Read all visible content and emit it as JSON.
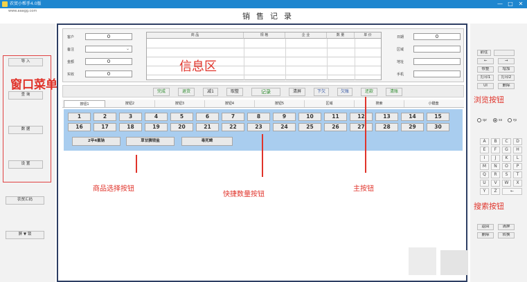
{
  "window": {
    "title": "农贸小帮手4.0版",
    "site": "www.aaagg.com",
    "controls": [
      "—",
      "□",
      "✕"
    ]
  },
  "app_title": "销售记录",
  "left_menu": {
    "buttons": [
      "导 入",
      "查 询",
      "数 据",
      "设 置"
    ],
    "bottom_buttons": [
      "农贸汇码",
      "屏 ▼ 锁"
    ],
    "annotation": "窗口菜单"
  },
  "info_zone": {
    "annotation": "信息区",
    "left_fields": [
      {
        "label": "客户",
        "value": "0"
      },
      {
        "label": "备注",
        "value": ""
      },
      {
        "label": "金额",
        "value": "0"
      },
      {
        "label": "实收",
        "value": "0"
      }
    ],
    "table_headers": [
      "商 品",
      "规 格",
      "企 业",
      "数 量",
      "单 价"
    ],
    "right_fields": [
      {
        "label": "日期",
        "value": "0"
      },
      {
        "label": "区域",
        "value": ""
      },
      {
        "label": "地址",
        "value": ""
      },
      {
        "label": "手机",
        "value": ""
      }
    ]
  },
  "main_buttons": {
    "annotation": "主按钮",
    "labels": [
      "完成",
      "退货",
      "减1",
      "取整",
      "记录",
      "清屏",
      "下欠",
      "欠账",
      "还款",
      "清账"
    ]
  },
  "tabs": [
    "按钮1",
    "按钮2",
    "按钮3",
    "按钮4",
    "按钮5",
    "区域",
    "搜索",
    "小键盘"
  ],
  "quantity": {
    "annotation": "快捷数量按钮",
    "row1": [
      "1",
      "2",
      "3",
      "4",
      "5",
      "6",
      "7",
      "8",
      "9",
      "10",
      "11",
      "12",
      "13",
      "14",
      "15"
    ],
    "row2": [
      "16",
      "17",
      "18",
      "19",
      "20",
      "21",
      "22",
      "23",
      "24",
      "25",
      "26",
      "27",
      "28",
      "29",
      "30"
    ]
  },
  "goods": {
    "annotation": "商品选择按钮",
    "buttons": [
      "2甲4氯钠",
      "草甘膦铵盐",
      "毒死蜱"
    ]
  },
  "browse": {
    "annotation": "浏览按钮",
    "buttons": [
      "前往",
      "←",
      "→",
      "修整",
      "增加",
      "打印1",
      "打印2",
      "UI",
      "删除"
    ],
    "radios": [
      "qz",
      "ss",
      "rp"
    ]
  },
  "search": {
    "annotation": "搜索按钮",
    "keys": [
      "A",
      "B",
      "C",
      "D",
      "E",
      "F",
      "G",
      "H",
      "I",
      "J",
      "K",
      "L",
      "M",
      "N",
      "O",
      "P",
      "Q",
      "R",
      "S",
      "T",
      "U",
      "V",
      "W",
      "X",
      "Y",
      "Z",
      "←"
    ],
    "bottom_buttons": [
      "返回",
      "清屏",
      "删除",
      "转换"
    ]
  },
  "colors": {
    "titlebar": "#1e86cf",
    "frame": "#2d3e63",
    "quantity_panel": "#a9cdef",
    "annotation": "#e0332a"
  }
}
